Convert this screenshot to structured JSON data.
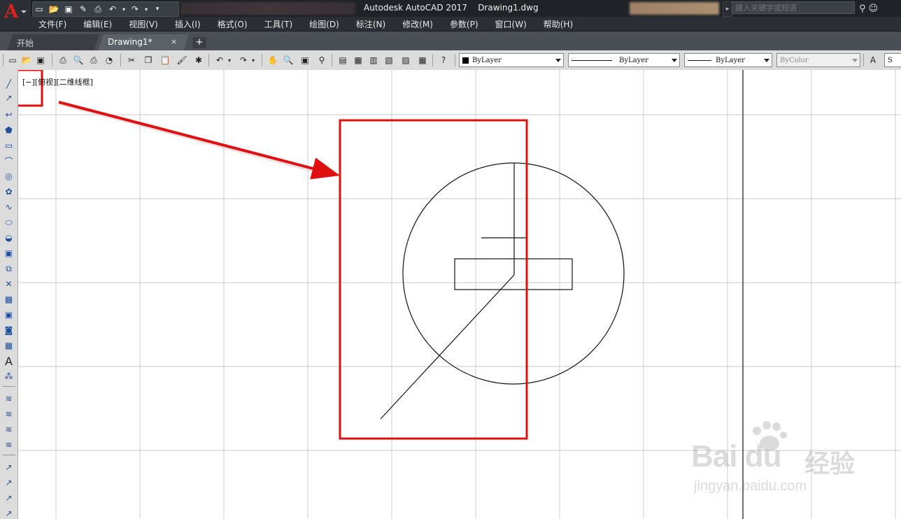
{
  "window": {
    "app_title": "Autodesk AutoCAD 2017",
    "document_title": "Drawing1.dwg",
    "search_placeholder": "键入关键字或短语"
  },
  "menu": [
    "文件(F)",
    "编辑(E)",
    "视图(V)",
    "插入(I)",
    "格式(O)",
    "工具(T)",
    "绘图(D)",
    "标注(N)",
    "修改(M)",
    "参数(P)",
    "窗口(W)",
    "帮助(H)"
  ],
  "tabs": [
    {
      "label": "开始",
      "active": false
    },
    {
      "label": "Drawing1*",
      "active": true
    }
  ],
  "tab_close": "×",
  "tab_add": "+",
  "properties": {
    "color": "ByLayer",
    "linetype": "ByLayer",
    "lineweight": "ByLayer",
    "plotstyle": "ByColor",
    "cut_text": "S"
  },
  "viewport_label": "[−][俯视][二维线框]",
  "colors": {
    "annotation_red": "#e01010",
    "title_bar": "#1f2328",
    "toolbar_bg": "#dcdcdc",
    "grid": "#c8c8c8"
  },
  "left_tools": [
    "line-icon",
    "ray-icon",
    "polyline-icon",
    "polygon-icon",
    "rectangle-icon",
    "arc-icon",
    "circle-icon",
    "revision-cloud-icon",
    "spline-icon",
    "ellipse-icon",
    "ellipse-arc-icon",
    "insert-block-icon",
    "make-block-icon",
    "point-icon",
    "hatch-icon",
    "gradient-icon",
    "region-icon",
    "table-icon",
    "text-icon",
    "add-selected-icon"
  ],
  "watermark": {
    "brand": "Bai du",
    "cn": "经验",
    "url": "jingyan.baidu.com"
  }
}
